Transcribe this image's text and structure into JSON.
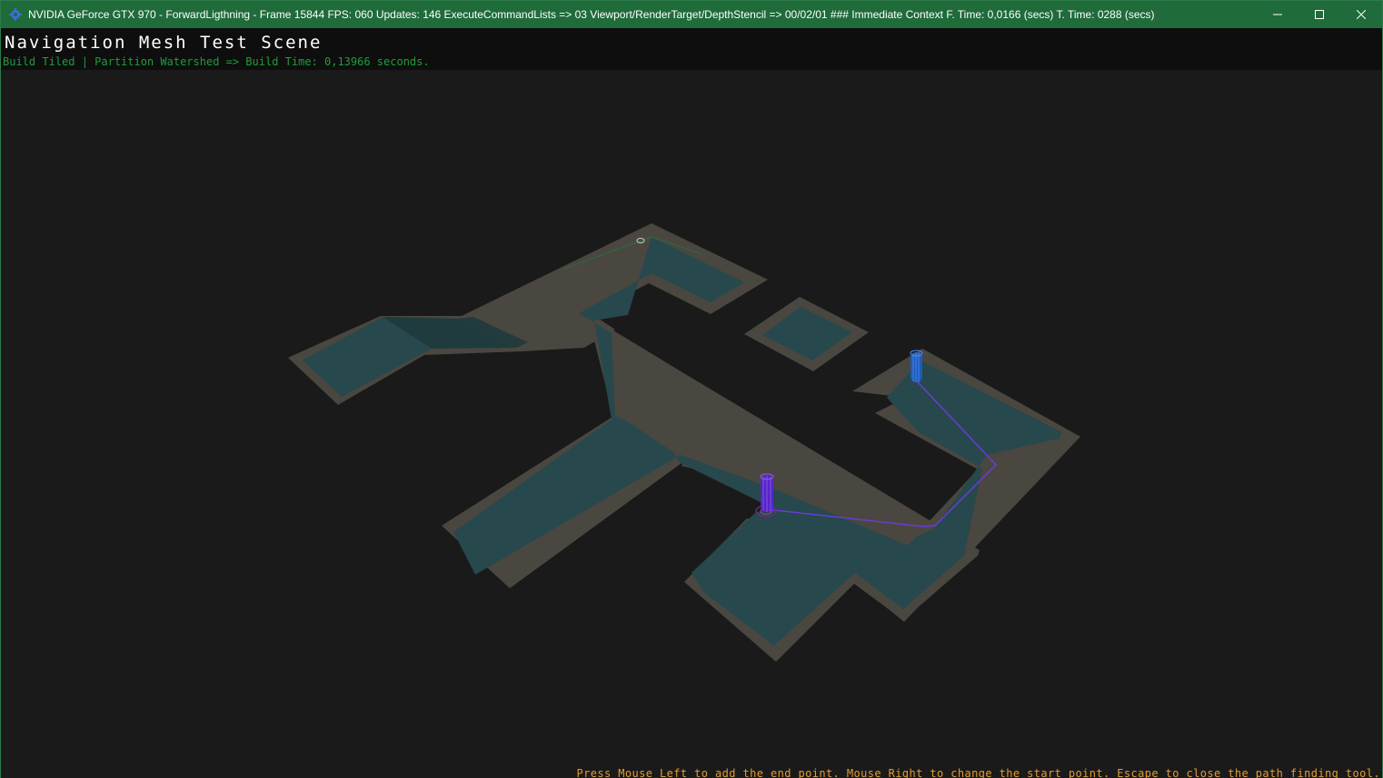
{
  "window": {
    "title": "NVIDIA GeForce GTX 970 - ForwardLigthning - Frame 15844 FPS: 060 Updates: 146 ExecuteCommandLists => 03 Viewport/RenderTarget/DepthStencil => 00/02/01 ### Immediate Context F. Time: 0,0166 (secs) T. Time: 0288 (secs)",
    "icon": "app-gear-icon",
    "controls": [
      "minimize-icon",
      "maximize-icon",
      "close-icon"
    ]
  },
  "scene": {
    "title": "Navigation Mesh Test Scene",
    "build_info": "Build Tiled | Partition Watershed => Build Time: 0,13966 seconds.",
    "help": "Press Mouse Left to add the end point. Mouse Right to change the start point. Escape to close the path finding tool."
  },
  "colors": {
    "titlebar": "#1f6b3a",
    "background": "#1a1a1a",
    "build_info": "#1f9e3a",
    "help": "#e59a2c",
    "floor": "#4a4740",
    "navmesh": "#27484c",
    "path": "#6a3bd8",
    "start_agent": "#1a5fd0",
    "end_agent": "#5a22d0"
  }
}
